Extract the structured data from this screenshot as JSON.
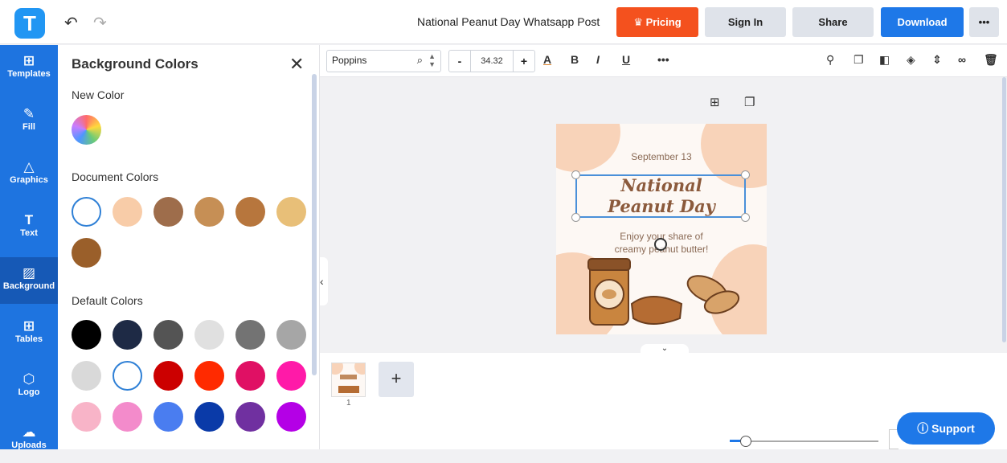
{
  "app": {
    "logo_letter": "T",
    "undo_icon": "↶",
    "redo_icon": "↷",
    "doc_title": "National Peanut Day Whatsapp Post"
  },
  "header": {
    "pricing_label": "Pricing",
    "signin_label": "Sign In",
    "share_label": "Share",
    "download_label": "Download",
    "more_label": "•••"
  },
  "sidebar": {
    "items": [
      {
        "label": "Templates",
        "icon": "template-icon"
      },
      {
        "label": "Fill",
        "icon": "pencil-icon"
      },
      {
        "label": "Graphics",
        "icon": "shapes-icon"
      },
      {
        "label": "Text",
        "icon": "text-icon"
      },
      {
        "label": "Background",
        "icon": "background-icon"
      },
      {
        "label": "Tables",
        "icon": "table-icon"
      },
      {
        "label": "Logo",
        "icon": "logo-icon"
      },
      {
        "label": "Uploads",
        "icon": "upload-icon"
      }
    ]
  },
  "panel": {
    "title": "Background Colors",
    "new_color_label": "New Color",
    "document_colors_label": "Document Colors",
    "document_colors": [
      "#ffffff",
      "#f8cca8",
      "#9e6d4b",
      "#c68f55",
      "#b7763d",
      "#e8bf78",
      "#9a5f2a"
    ],
    "default_colors_label": "Default Colors",
    "default_colors": [
      "#000000",
      "#1e2a45",
      "#545454",
      "#e0e0e0",
      "#737373",
      "#a6a6a6",
      "#d9d9d9",
      "#ffffff",
      "#cc0000",
      "#ff2a00",
      "#e01064",
      "#ff1aa8",
      "#f8b4c8",
      "#f38bcb",
      "#4a7df0",
      "#0a3aa8",
      "#7030a0",
      "#b400e6"
    ]
  },
  "toolbar": {
    "font_name": "Poppins",
    "font_size": "34.32",
    "minus_label": "-",
    "plus_label": "+"
  },
  "canvas": {
    "date_text": "September 13",
    "title_line1": "National",
    "title_line2": "Peanut Day",
    "subtitle_line1": "Enjoy your share of",
    "subtitle_line2": "creamy peanut butter!"
  },
  "pages": {
    "page_number": "1",
    "add_label": "+"
  },
  "support": {
    "label": "Support"
  },
  "colors": {
    "brand": "#1e74e0",
    "pricing": "#f4511e",
    "download": "#1e78e8"
  }
}
